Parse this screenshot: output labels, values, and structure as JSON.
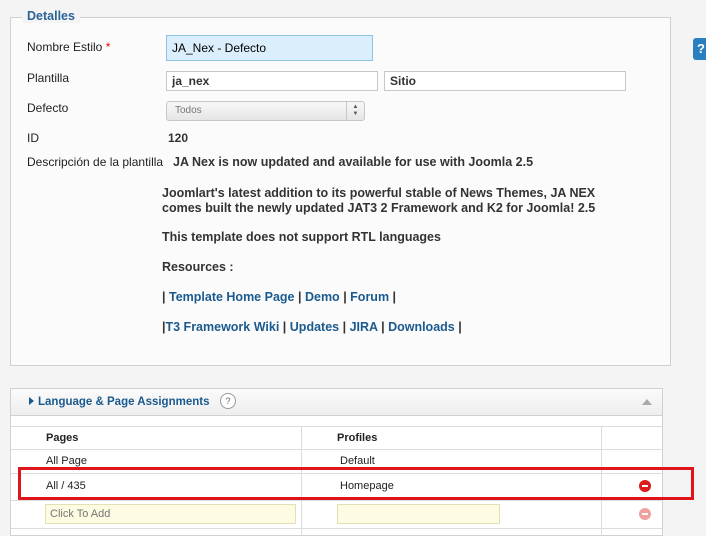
{
  "details": {
    "legend": "Detalles",
    "style_name_label": "Nombre Estilo",
    "required_mark": "*",
    "style_name_value": "JA_Nex - Defecto",
    "template_label": "Plantilla",
    "template_value": "ja_nex",
    "client_value": "Sitio",
    "default_label": "Defecto",
    "default_value": "Todos",
    "id_label": "ID",
    "id_value": "120",
    "desc_label": "Descripción de la plantilla",
    "desc_line1": "JA Nex is now updated and available for use with Joomla 2.5",
    "desc_para2_line1": "Joomlart's latest addition to its powerful stable of News Themes, JA NEX",
    "desc_para2_line2": "comes built the newly updated JAT3 2 Framework and K2 for Joomla! 2.5",
    "desc_rtl": "This template does not support RTL languages",
    "resources_label": "Resources :",
    "sep": "|",
    "links1": [
      "Template Home Page",
      "Demo",
      "Forum"
    ],
    "links2": [
      "T3 Framework Wiki",
      "Updates",
      "JIRA",
      "Downloads"
    ]
  },
  "help_badge": "?",
  "assignments": {
    "title": "Language & Page Assignments",
    "help": "?",
    "columns": [
      "Pages",
      "Profiles"
    ],
    "rows": [
      {
        "page": "All Page",
        "profile": "Default"
      },
      {
        "page": "All / 435",
        "profile": "Homepage"
      }
    ],
    "add_placeholder": "Click To Add"
  },
  "colors": {
    "highlight": "#e0141b",
    "link": "#1b5a8f",
    "remove": "#d91c1c"
  }
}
